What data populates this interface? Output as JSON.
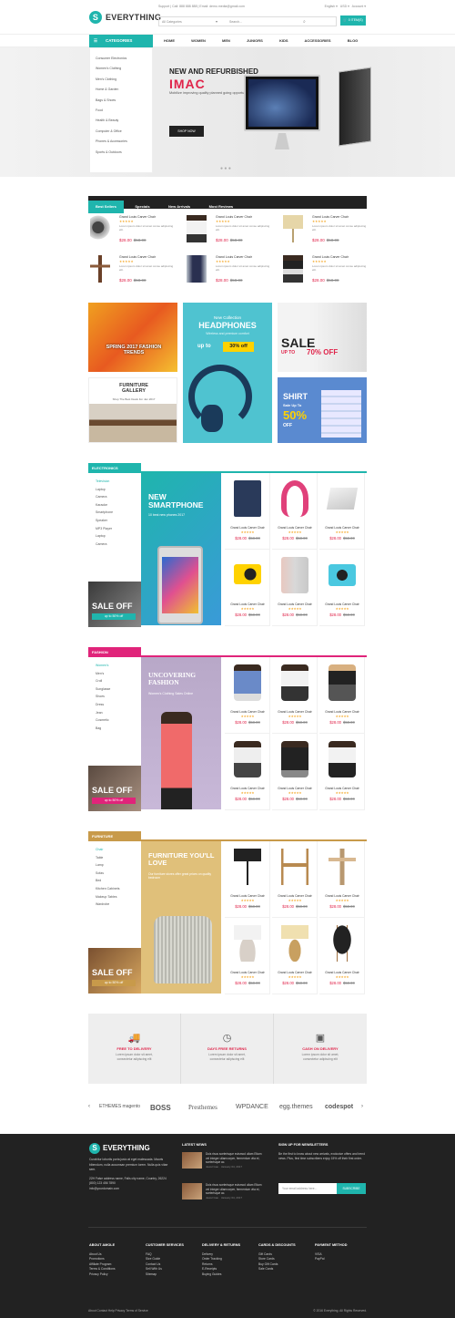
{
  "header": {
    "brand": "EVERYTHING",
    "support": "Support | Call: 888 888 888 | Email: demo.media@gmail.com",
    "top_links": [
      "English",
      "USD",
      "Account"
    ],
    "search_category": "All Categories",
    "search_placeholder": "Search...",
    "cart_label": "0 ITEM(S)"
  },
  "nav": {
    "categories_label": "CATEGORIES",
    "items": [
      "HOME",
      "WOMEN",
      "MEN",
      "JUNIORS",
      "KIDS",
      "ACCESSORIES",
      "BLOG"
    ]
  },
  "sidebar_categories": [
    "Consumer Electronics",
    "Women's Clothing",
    "Men's Clothing",
    "Home & Garden",
    "Bags & Shoes",
    "Food",
    "Health & Beauty",
    "Computer & Office",
    "Phones & Accessories",
    "Sports & Outdoors"
  ],
  "hero": {
    "subtitle": "NEW AND REFURBISHED",
    "title": "IMAC",
    "description": "Mobilize improving quality planned going opportunity poverty enable crowdsourcing.",
    "button": "SHOP NOW",
    "slide_dots": "● ● ●"
  },
  "product_tabs": [
    "Best Sellers",
    "Specials",
    "New Arrivals",
    "Most Reviews"
  ],
  "products": {
    "name": "Grand Louis Carver Chair",
    "stars": "★★★★★",
    "desc": "Lorem ipsum dolor sit amet conse adipiscing elit.",
    "price": "$28.00",
    "old_price": "$58.00"
  },
  "banners": {
    "spring": "SPRING 2017 FASHION TRENDS",
    "headphones_kicker": "New Collection",
    "headphones_title": "HEADPHONES",
    "headphones_sub": "Wireless and premium comfort",
    "headphones_upto": "up to",
    "headphones_off": "30% off",
    "sale_big": "SALE",
    "sale_upto": "UP TO",
    "sale_pct": "70% OFF",
    "furniture_title": "FURNITURE GALLERY",
    "furniture_sub": "Shop The Best Deals For Jan 2017",
    "shirt": "SHIRT",
    "shirt_sale": "Sale Up To",
    "shirt_pct": "50%",
    "shirt_off": "OFF"
  },
  "electronics": {
    "header": "ELECTRONICS",
    "side": [
      "Television",
      "Laptop",
      "Camera",
      "Karaoke",
      "Smartphone",
      "Speaker",
      "MP3 Player",
      "Laptop",
      "Camera"
    ],
    "promo_title": "NEW SMARTPHONE",
    "promo_sub": "10 best new phones 2017",
    "sale": "SALE OFF",
    "sale_badge": "up to 50% off"
  },
  "fashion": {
    "header": "FASHION",
    "side": [
      "Women's",
      "Men's",
      "Croll",
      "Sunglasse",
      "Shoes",
      "Dress",
      "Jean",
      "Cosmetic",
      "Bag"
    ],
    "promo_title": "UNCOVERING FASHION",
    "promo_sub": "Women's Clothing Sales Online",
    "sale": "SALE OFF",
    "sale_badge": "up to 50% off"
  },
  "furniture": {
    "header": "FURNITURE",
    "side": [
      "Chair",
      "Table",
      "Lamp",
      "Sofas",
      "Bed",
      "Kitchen Cabinets",
      "Makeup Tables",
      "Wardrobe"
    ],
    "promo_title": "FURNITURE YOU'LL LOVE",
    "promo_sub": "Our furniture stores offer great prices on quality bedroom",
    "sale": "SALE OFF",
    "sale_badge": "up to 50% off"
  },
  "features": [
    {
      "icon": "truck-icon",
      "title": "FREE TO DELIVERY",
      "desc": "Lorem ipsum dolor sit amet, consectetur adipiscing elit"
    },
    {
      "icon": "clock-24-icon",
      "title": "DAYS FREE RETURNS",
      "desc": "Lorem ipsum dolor sit amet, consectetur adipiscing elit"
    },
    {
      "icon": "box-icon",
      "title": "CASH ON DELIVERY",
      "desc": "Lorem ipsum dolor sit amet, consectetur adipiscing elit"
    }
  ],
  "brands": [
    "ETHEMES magento",
    "BOSS",
    "Presthemes",
    "WPDANCE",
    "egg.themes",
    "codespot"
  ],
  "footer": {
    "brand": "EVERYTHING",
    "about": "Curabitur lobortis porta justo at eget malesuada. Mauris bibendum, nulla accumsan premium lorem. Nulla quis vitae sem.",
    "address": "22H False address name, Falls city name, Country, 26224",
    "phone": "(800) 123 456 7890",
    "email": "info@yourdomain.com",
    "latest_news": "LATEST NEWS",
    "news_text": "Duis risus scelerisque euismod ullam Etiam vel integer ullamcorper, fermentum vita et, scelerisque ac.",
    "news_date": "Jewel Gao · January 04, 2017",
    "signup": "SIGN UP FOR NEWSLETTERS",
    "signup_desc": "Be the first to know about new arrivals, exclusive offers and trend news. Plus, first time subscribers enjoy 15% off their first order.",
    "email_placeholder": "Your email address here...",
    "subscribe": "SUBSCRIBE",
    "cols": [
      {
        "title": "ABOUT AMOLE",
        "items": [
          "About Us",
          "Promotions",
          "Affiliate Program",
          "Terms & Conditions",
          "Privacy Policy"
        ]
      },
      {
        "title": "CUSTOMER SERVICES",
        "items": [
          "FAQ",
          "Size Guide",
          "Contact Us",
          "Sell With Us",
          "Sitemap"
        ]
      },
      {
        "title": "DELIVERY & RETURNS",
        "items": [
          "Delivery",
          "Order Tracking",
          "Returns",
          "E-Receipts",
          "Buying Guides"
        ]
      },
      {
        "title": "CARDS & DISCOUNTS",
        "items": [
          "Gift Cards",
          "Store Cards",
          "Buy Gift Cards",
          "Sale Cards"
        ]
      },
      {
        "title": "PAYMENT METHOD",
        "items": [
          "VISA",
          "PayPal"
        ]
      }
    ],
    "bottom_links": "About   Contact   Help   Privacy   Terms of Service",
    "copyright": "© 2016 Everything. All Rights Reserved."
  }
}
